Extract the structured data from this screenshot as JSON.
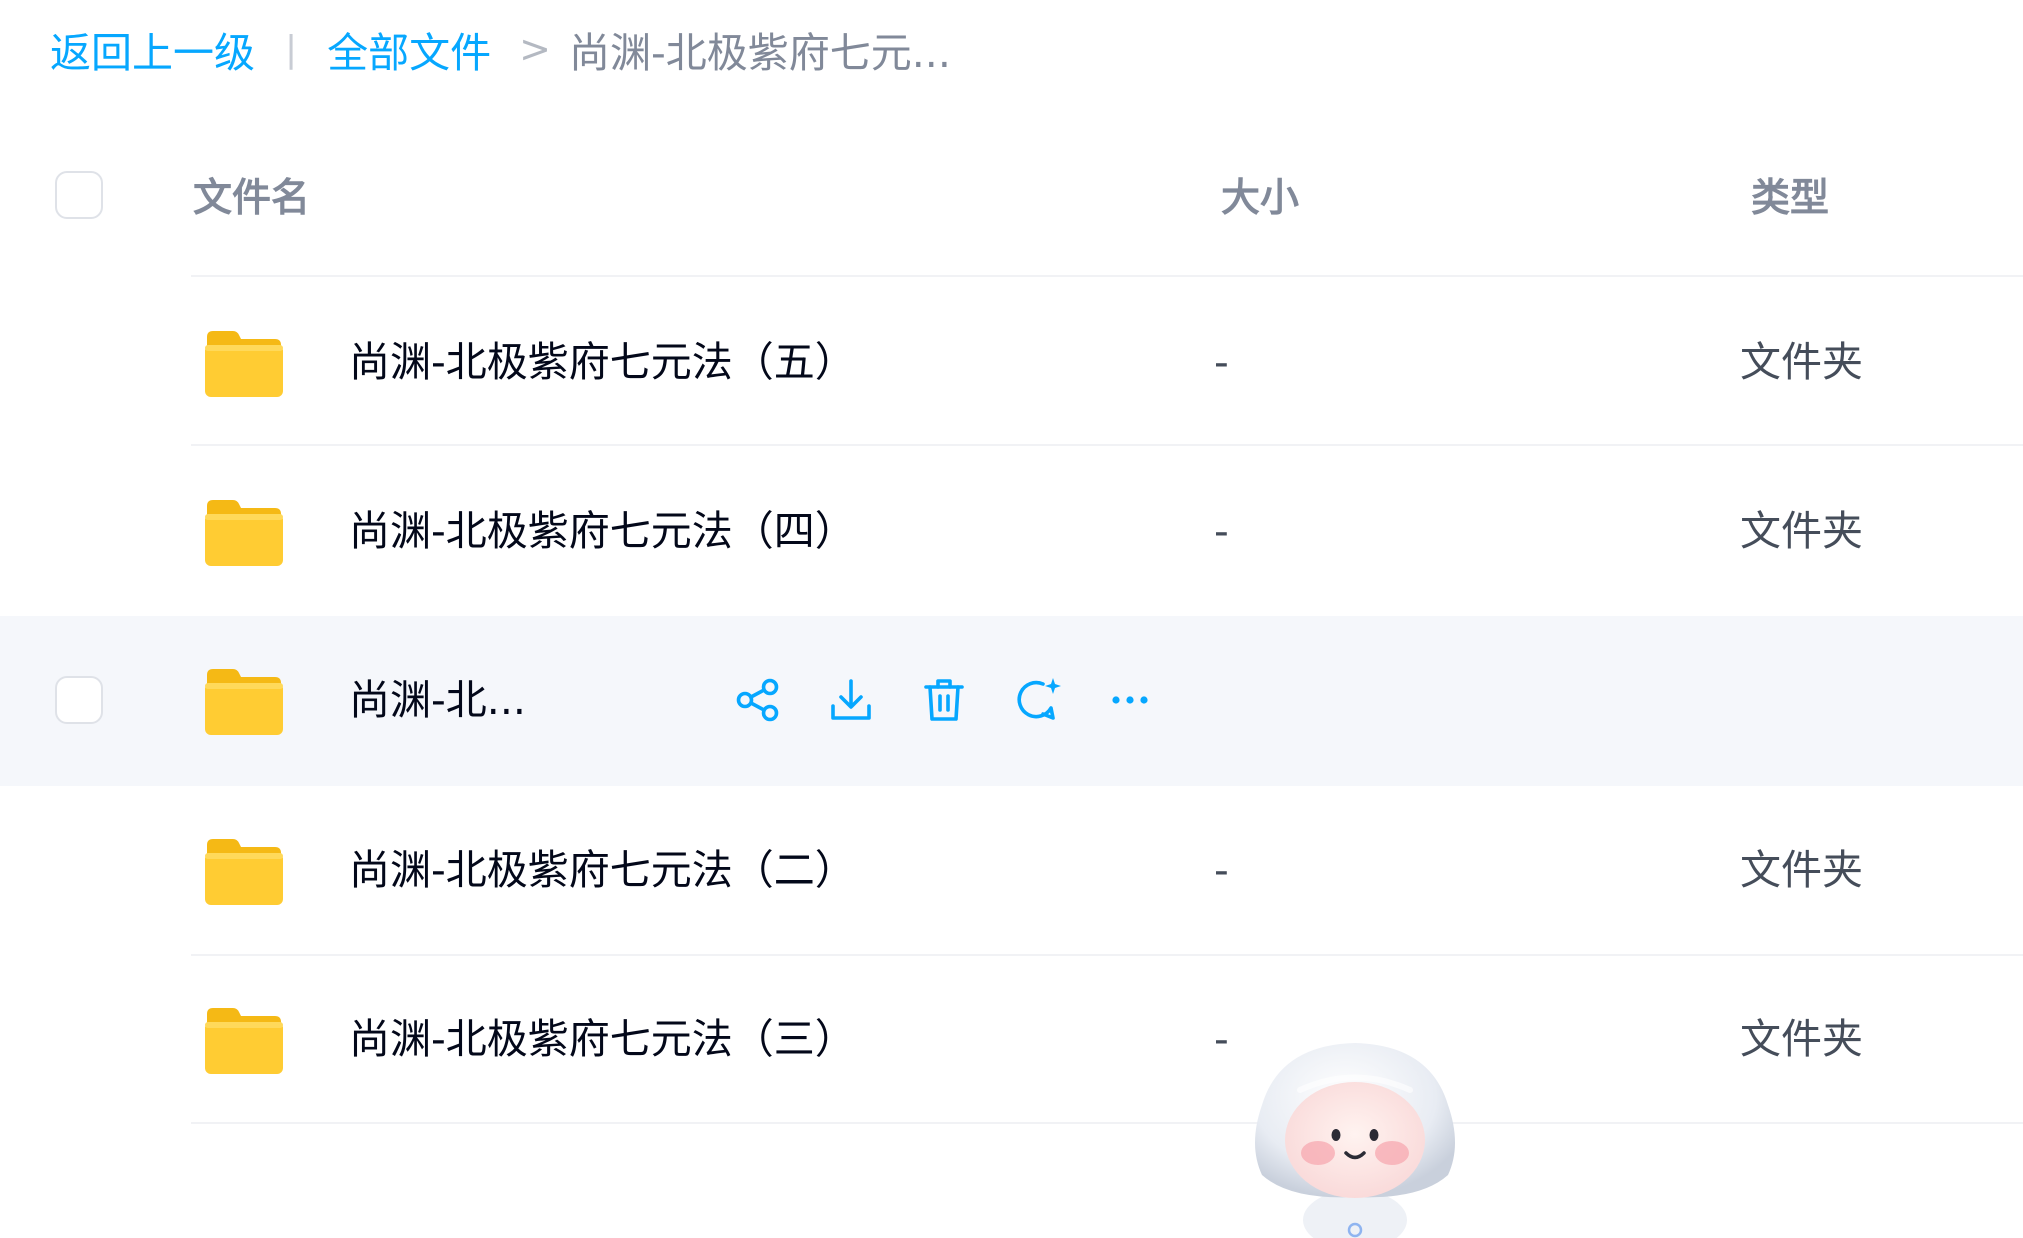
{
  "breadcrumb": {
    "back": "返回上一级",
    "separator": "|",
    "all_files": "全部文件",
    "arrow": ">",
    "current": "尚渊-北极紫府七元..."
  },
  "table": {
    "columns": {
      "name": "文件名",
      "size": "大小",
      "type": "类型"
    },
    "rows": [
      {
        "name": "尚渊-北极紫府七元法（五）",
        "size": "-",
        "type": "文件夹"
      },
      {
        "name": "尚渊-北极紫府七元法（四）",
        "size": "-",
        "type": "文件夹"
      },
      {
        "name": "尚渊-北...",
        "size": "",
        "type": ""
      },
      {
        "name": "尚渊-北极紫府七元法（二）",
        "size": "-",
        "type": "文件夹"
      },
      {
        "name": "尚渊-北极紫府七元法（三）",
        "size": "-",
        "type": "文件夹"
      }
    ],
    "hover_row_actions": [
      "share-icon",
      "download-icon",
      "delete-icon",
      "ai-chat-icon",
      "more-icon"
    ]
  },
  "colors": {
    "accent": "#06a7ff",
    "folder": "#ffcc33",
    "hover_row_bg": "#f5f7fb",
    "header_text": "#818999"
  },
  "mascot": {
    "icon": "assistant-mascot-icon"
  }
}
